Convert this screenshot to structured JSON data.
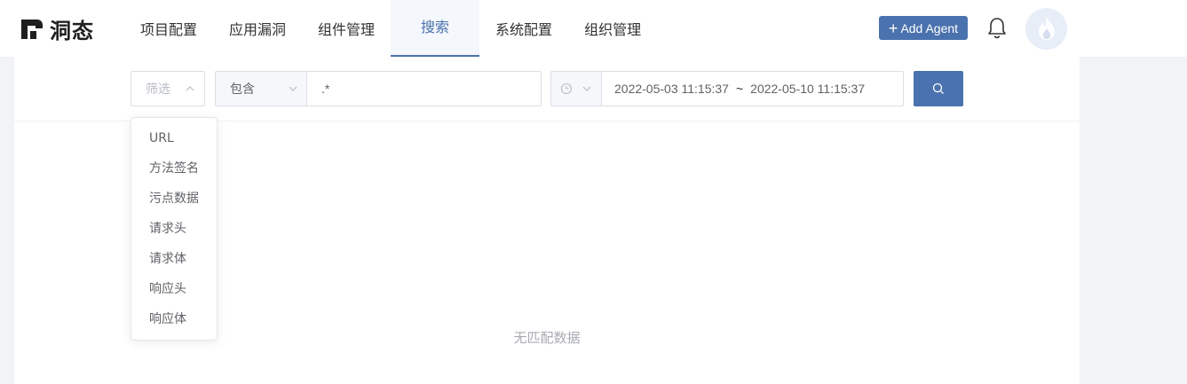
{
  "logo": {
    "text": "洞态"
  },
  "nav": {
    "items": [
      {
        "label": "项目配置"
      },
      {
        "label": "应用漏洞"
      },
      {
        "label": "组件管理"
      },
      {
        "label": "搜索",
        "active": true
      },
      {
        "label": "系统配置"
      },
      {
        "label": "组织管理"
      }
    ]
  },
  "header": {
    "add_agent_label": "Add Agent"
  },
  "search": {
    "filter_placeholder": "筛选",
    "operator": "包含",
    "keyword": ".*",
    "date_start": "2022-05-03 11:15:37",
    "date_separator": "~",
    "date_end": "2022-05-10 11:15:37"
  },
  "filter_options": [
    "URL",
    "方法签名",
    "污点数据",
    "请求头",
    "请求体",
    "响应头",
    "响应体"
  ],
  "results": {
    "empty_text": "无匹配数据"
  },
  "colors": {
    "primary": "#4a72ae",
    "background": "#f2f3f5"
  },
  "icons": {
    "bell": "bell-icon",
    "search": "search-icon",
    "clock": "clock-icon",
    "avatar": "flame-icon"
  }
}
